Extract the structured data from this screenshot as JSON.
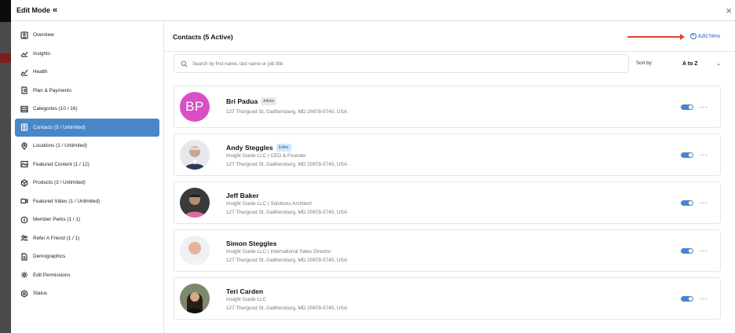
{
  "header": {
    "title": "Edit Mode",
    "collapse_icon": "«",
    "close_icon": "×"
  },
  "sidebar": {
    "items": [
      {
        "label": "Overview",
        "icon": "id-card-icon"
      },
      {
        "label": "Insights",
        "icon": "trend-up-icon"
      },
      {
        "label": "Health",
        "icon": "pulse-chart-icon"
      },
      {
        "label": "Plan & Payments",
        "icon": "receipt-icon"
      },
      {
        "label": "Categories (10 / 16)",
        "icon": "list-icon"
      },
      {
        "label": "Contacts (5 / Unlimited)",
        "icon": "contact-card-icon",
        "active": true
      },
      {
        "label": "Locations (1 / Unlimited)",
        "icon": "location-pin-icon"
      },
      {
        "label": "Featured Content (1 / 12)",
        "icon": "image-icon"
      },
      {
        "label": "Products (3 / Unlimited)",
        "icon": "box-icon"
      },
      {
        "label": "Featured Video (1 / Unlimited)",
        "icon": "video-icon"
      },
      {
        "label": "Member Perks (1 / 1)",
        "icon": "coin-icon"
      },
      {
        "label": "Refer A Friend (1 / 1)",
        "icon": "users-icon"
      },
      {
        "label": "Demographics",
        "icon": "document-icon"
      },
      {
        "label": "Edit Permissions",
        "icon": "gear-icon"
      },
      {
        "label": "Status",
        "icon": "settings-badge-icon"
      }
    ]
  },
  "main": {
    "heading": "Contacts (5 Active)",
    "add_new_label": "Add New",
    "search_placeholder": "Search by first name, last name or job title",
    "sort_label": "Sort by:",
    "sort_value": "A to Z"
  },
  "contacts": [
    {
      "name": "Bri Padua",
      "role": "Admin",
      "initials": "BP",
      "line1": "127 Thurgood St, Gaithersburg, MD 20878-5745, USA",
      "line2": "",
      "enabled": true
    },
    {
      "name": "Andy Steggles",
      "role": "Editor",
      "line1": "Insight Guide LLC | CEO & Founder",
      "line2": "127 Thurgood St, Gaithersburg, MD 20878-5745, USA",
      "enabled": true
    },
    {
      "name": "Jeff Baker",
      "role": "",
      "line1": "Insight Guide LLC | Solutions Architect",
      "line2": "127 Thurgood St, Gaithersburg, MD 20878-5745, USA",
      "enabled": true
    },
    {
      "name": "Simon Steggles",
      "role": "",
      "line1": "Insight Guide LLC | International Sales Director",
      "line2": "127 Thurgood St, Gaithersburg, MD 20878-5745, USA",
      "enabled": true
    },
    {
      "name": "Teri Carden",
      "role": "",
      "line1": "Insight Guide LLC",
      "line2": "127 Thurgood St, Gaithersburg, MD 20878-5745, USA",
      "enabled": true
    }
  ],
  "colors": {
    "accent": "#4a87c9",
    "link": "#2f6fc0",
    "arrow": "#e0442f"
  }
}
